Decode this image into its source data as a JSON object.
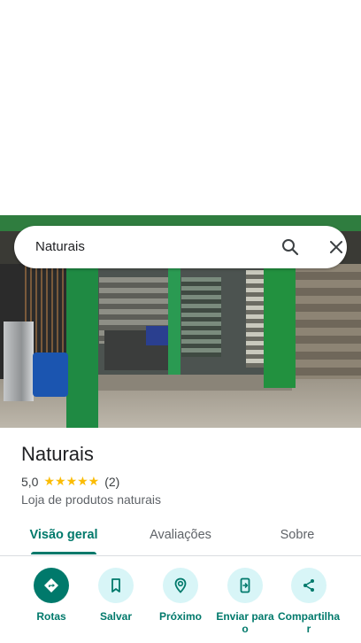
{
  "search": {
    "query": "Naturais"
  },
  "place": {
    "name": "Naturais",
    "rating": "5,0",
    "stars": "★★★★★",
    "review_count": "(2)",
    "category": "Loja de produtos naturais"
  },
  "tabs": [
    {
      "label": "Visão geral",
      "active": true
    },
    {
      "label": "Avaliações",
      "active": false
    },
    {
      "label": "Sobre",
      "active": false
    }
  ],
  "actions": [
    {
      "label": "Rotas",
      "icon": "directions-icon",
      "primary": true
    },
    {
      "label": "Salvar",
      "icon": "bookmark-icon",
      "primary": false
    },
    {
      "label": "Próximo",
      "icon": "nearby-icon",
      "primary": false
    },
    {
      "label": "Enviar para o",
      "icon": "send-to-phone-icon",
      "primary": false
    },
    {
      "label": "Compartilha r",
      "icon": "share-icon",
      "primary": false
    }
  ],
  "colors": {
    "accent": "#00796b",
    "action_bg": "#d8f5f7",
    "star": "#fbbc04"
  }
}
